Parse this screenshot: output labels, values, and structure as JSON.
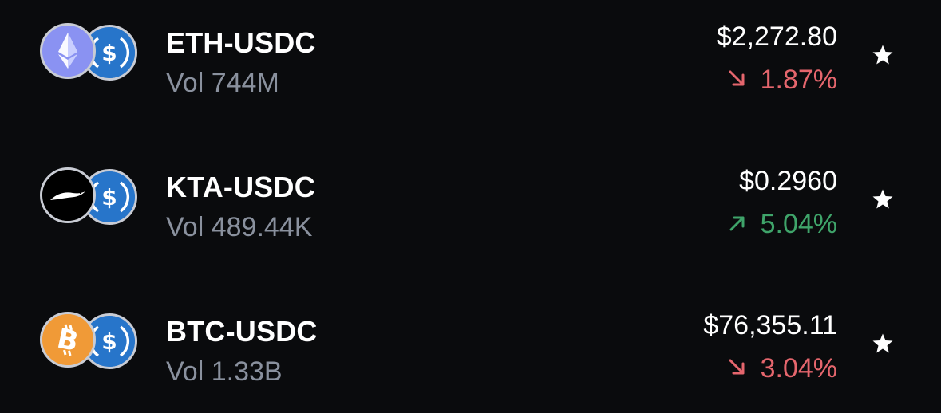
{
  "colors": {
    "background": "#0a0b0d",
    "negative": "#e5666d",
    "positive": "#3fa46a",
    "volume_text": "#8a919e",
    "usdc_blue": "#2775ca",
    "eth_purple": "#8a92f2",
    "btc_orange": "#f7931a"
  },
  "markets": [
    {
      "pair": "ETH-USDC",
      "volume": "Vol 744M",
      "price": "$2,272.80",
      "change": "1.87%",
      "direction": "down",
      "base_icon": "eth-icon",
      "quote_icon": "usdc-icon",
      "watchlist_icon": "star-icon"
    },
    {
      "pair": "KTA-USDC",
      "volume": "Vol 489.44K",
      "price": "$0.2960",
      "change": "5.04%",
      "direction": "up",
      "base_icon": "kta-icon",
      "quote_icon": "usdc-icon",
      "watchlist_icon": "star-icon"
    },
    {
      "pair": "BTC-USDC",
      "volume": "Vol 1.33B",
      "price": "$76,355.11",
      "change": "3.04%",
      "direction": "down",
      "base_icon": "btc-icon",
      "quote_icon": "usdc-icon",
      "watchlist_icon": "star-icon"
    }
  ]
}
